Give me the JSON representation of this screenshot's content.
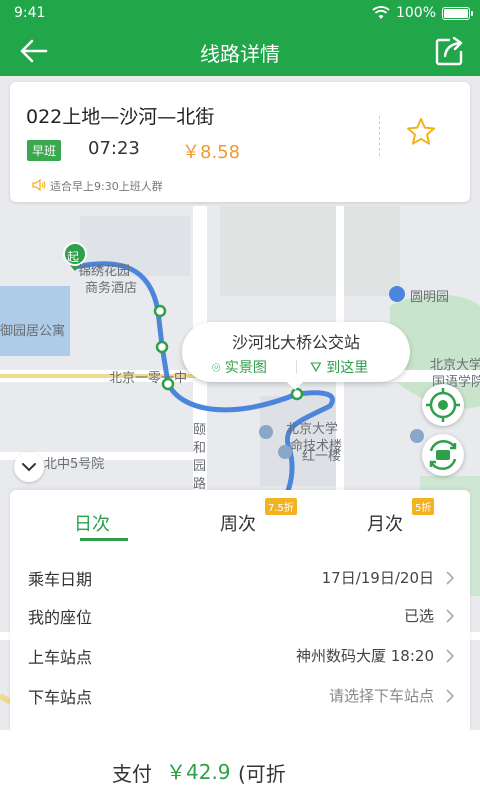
{
  "status_bar": {
    "time": "9:41",
    "battery": "100%"
  },
  "header": {
    "title": "线路详情"
  },
  "route_card": {
    "name": "022上地—沙河—北街",
    "badge": "早班",
    "depart_time": "07:23",
    "price": "￥8.58",
    "hint": "适合早上9:30上班人群"
  },
  "map": {
    "labels": {
      "hotel_a": "锦绣花园",
      "hotel_b": "商务酒店",
      "community": "御园居公寓",
      "road": "北京一零一中",
      "park": "圆明园",
      "road2": "颐和园路",
      "pku": "北京大学生",
      "pku2": "命技术楼",
      "pku3": "北京大学",
      "pku4": "国语学院",
      "redbuilding": "红一楼",
      "line5": "北中5号院"
    },
    "start_marker": "起",
    "stop_popup": {
      "name": "沙河北大桥公交站",
      "btn_scene": "实景图",
      "btn_go": "到这里"
    }
  },
  "tabs": [
    {
      "label": "日次",
      "discount": ""
    },
    {
      "label": "周次",
      "discount": "7.5折"
    },
    {
      "label": "月次",
      "discount": "5折"
    }
  ],
  "rows": [
    {
      "label": "乘车日期",
      "value": "17日/19日/20日"
    },
    {
      "label": "我的座位",
      "value": "已选"
    },
    {
      "label": "上车站点",
      "value": "神州数码大厦 18:20"
    },
    {
      "label": "下车站点",
      "value": "请选择下车站点"
    }
  ],
  "pay": {
    "label": "支付",
    "amount": "￥42.9",
    "note": "(可折"
  },
  "colors": {
    "brand": "#22a64a",
    "price": "#f29a2e",
    "discount_tag": "#f3b321",
    "route_line": "#4b85dc"
  }
}
